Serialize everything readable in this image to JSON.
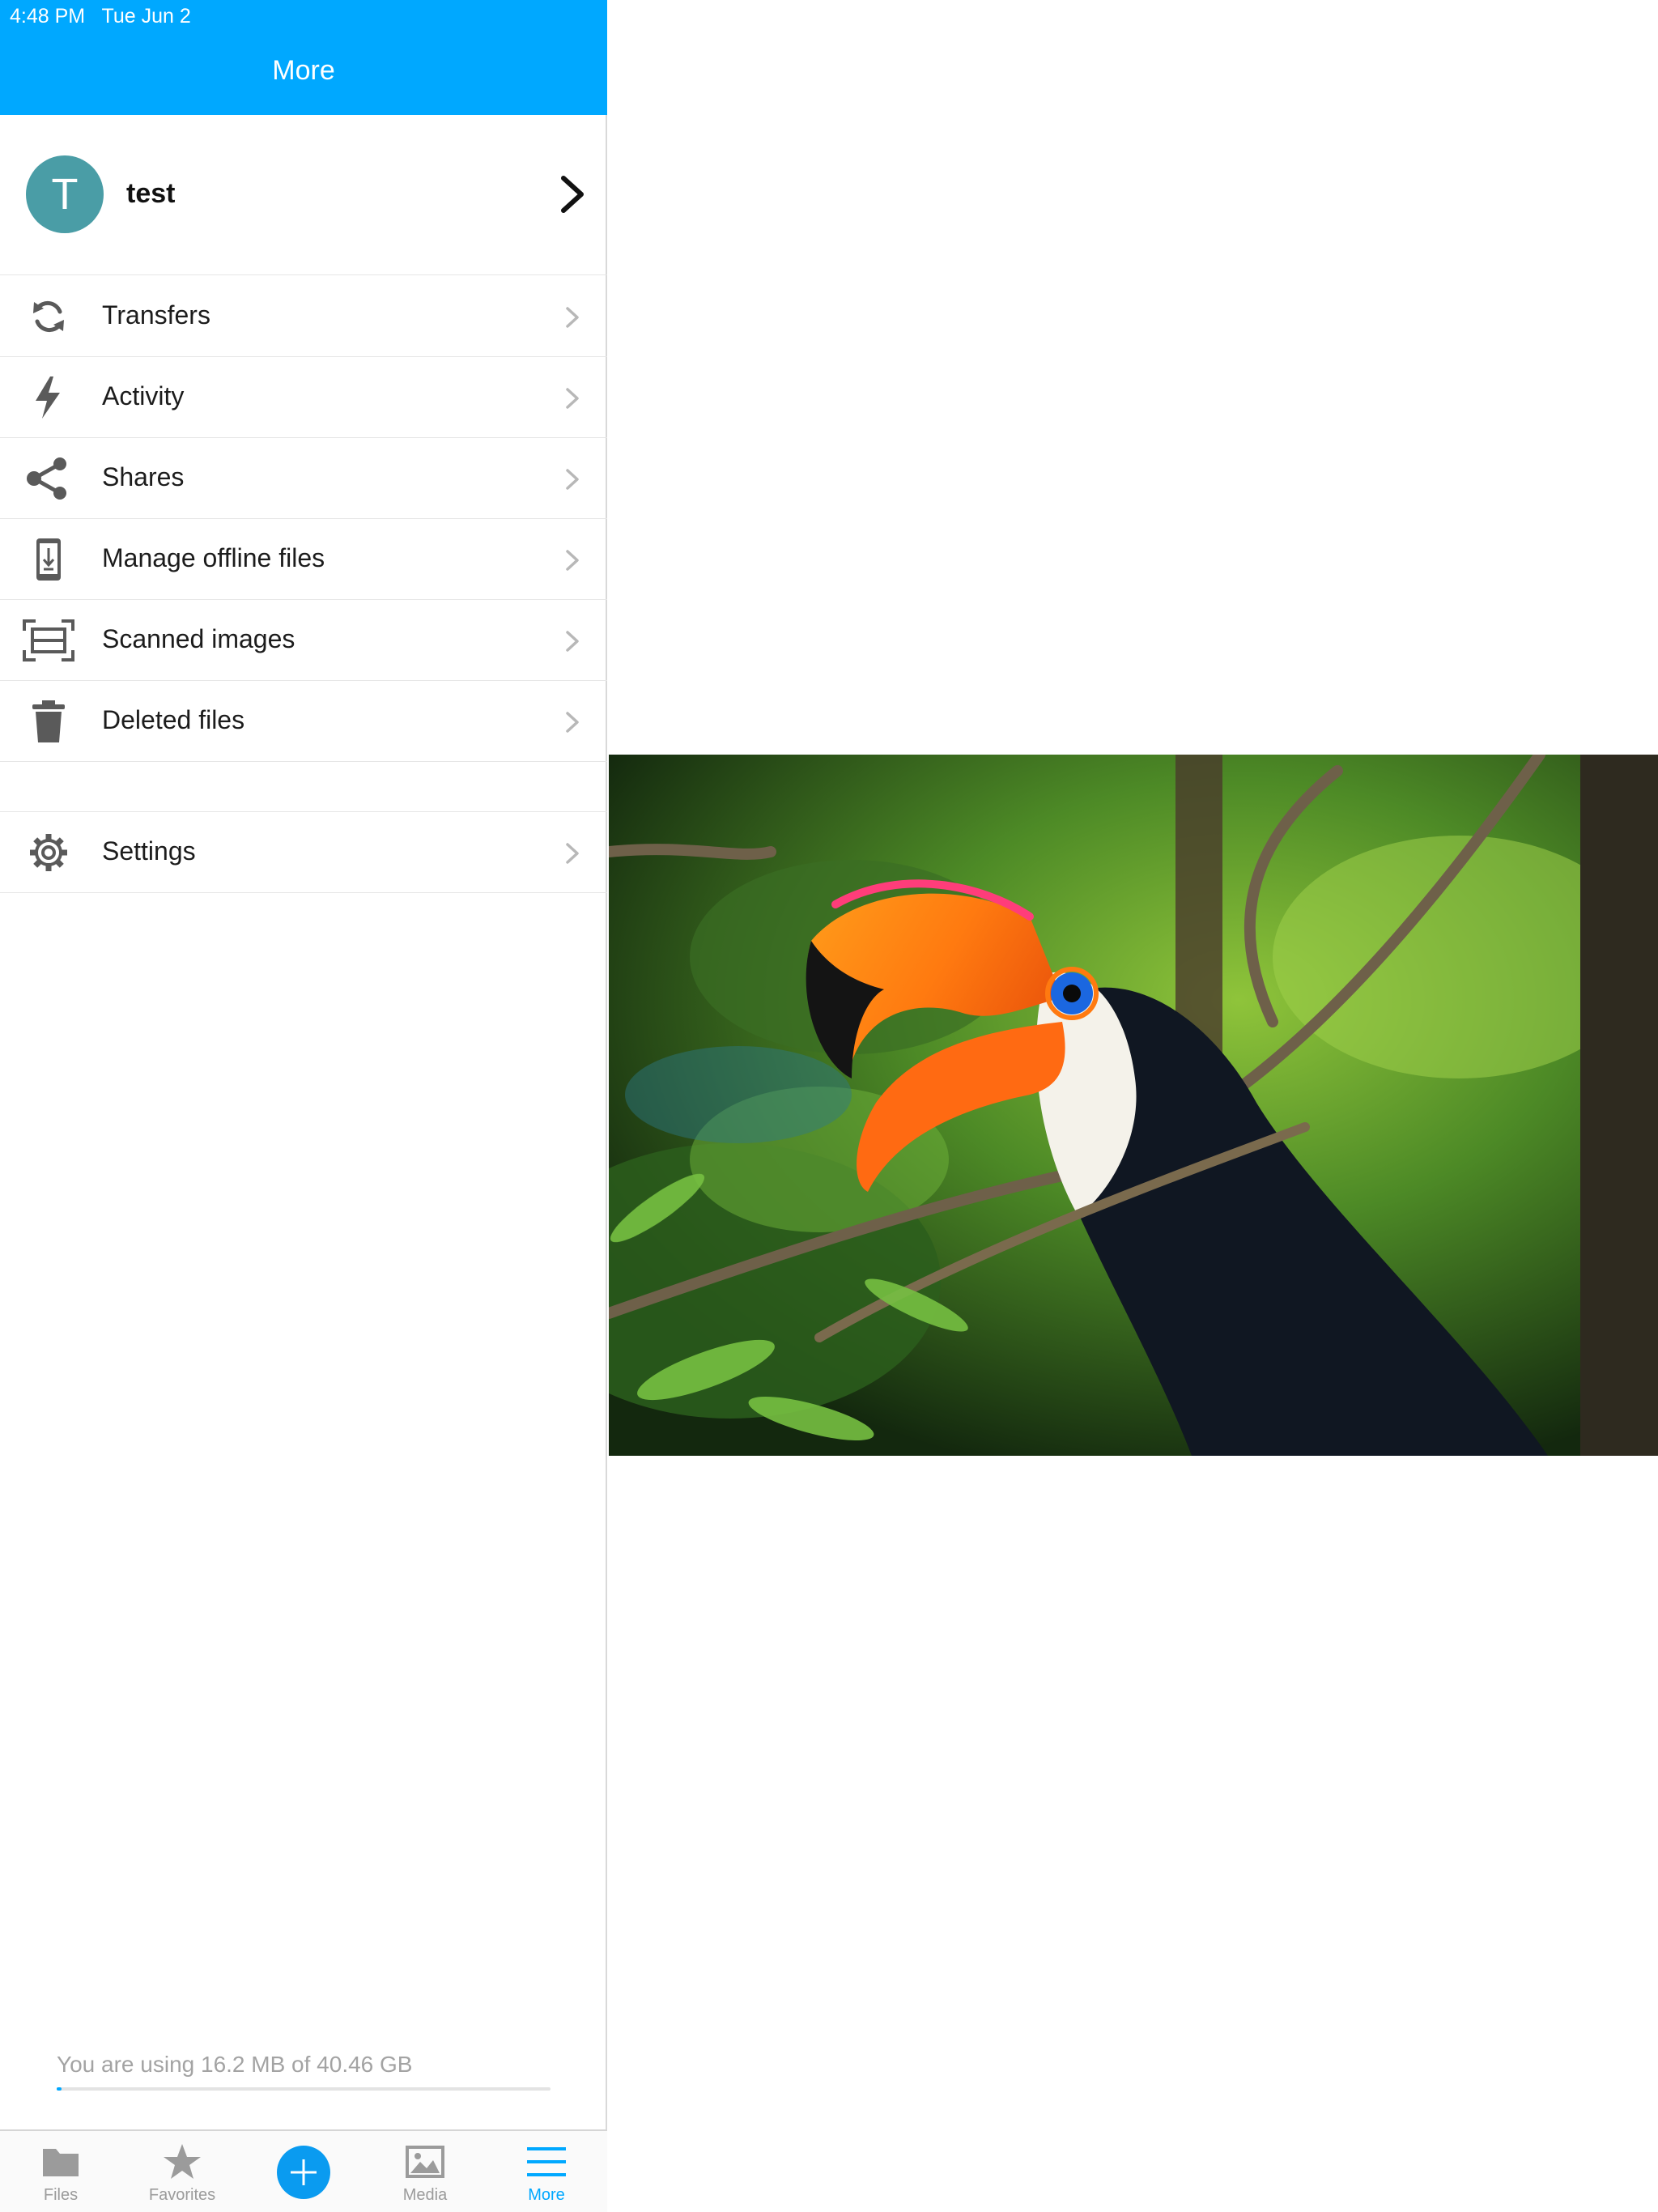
{
  "status_bar": {
    "time": "4:48 PM",
    "date": "Tue Jun 2"
  },
  "header": {
    "title": "More"
  },
  "account": {
    "initial": "T",
    "name": "test"
  },
  "menu": {
    "items": [
      {
        "label": "Transfers",
        "icon": "sync-icon"
      },
      {
        "label": "Activity",
        "icon": "lightning-icon"
      },
      {
        "label": "Shares",
        "icon": "share-icon"
      },
      {
        "label": "Manage offline files",
        "icon": "offline-device-icon"
      },
      {
        "label": "Scanned images",
        "icon": "scan-icon"
      },
      {
        "label": "Deleted files",
        "icon": "trash-icon"
      }
    ],
    "settings": {
      "label": "Settings",
      "icon": "gear-icon"
    }
  },
  "usage": {
    "text": "You are using 16.2 MB of 40.46 GB",
    "fraction": 0.01
  },
  "tabs": [
    {
      "label": "Files",
      "icon": "folder-icon",
      "active": false
    },
    {
      "label": "Favorites",
      "icon": "star-icon",
      "active": false
    },
    {
      "label": "",
      "icon": "plus-icon",
      "active": false
    },
    {
      "label": "Media",
      "icon": "image-icon",
      "active": false
    },
    {
      "label": "More",
      "icon": "menu-icon",
      "active": true
    }
  ],
  "colors": {
    "accent": "#00a8ff",
    "avatar": "#4a9da6",
    "icon_gray": "#5a5a5a"
  },
  "detail": {
    "image_subject": "toucan-photo"
  }
}
